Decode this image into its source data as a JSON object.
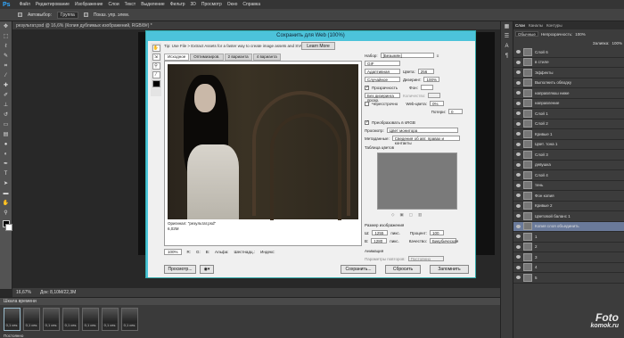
{
  "app": {
    "menu": [
      "Файл",
      "Редактирование",
      "Изображение",
      "Слои",
      "Текст",
      "Выделение",
      "Фильтр",
      "3D",
      "Просмотр",
      "Окно",
      "Справка"
    ],
    "options": {
      "autoselect": "Автовыбор:",
      "group": "Группа",
      "show_controls": "Показ. упр. элем."
    },
    "doc_tab": "результат.psd @ 16,6% (Копия дублимых изображений, RGB/8#) *",
    "status": {
      "zoom": "16,67%",
      "doc": "Док: 8,10M/22,3M"
    }
  },
  "timeline": {
    "title": "Шкала времени",
    "frames": [
      {
        "n": "1",
        "d": "0,1 сек."
      },
      {
        "n": "2",
        "d": "0,1 сек."
      },
      {
        "n": "3",
        "d": "0,1 сек."
      },
      {
        "n": "4",
        "d": "0,1 сек."
      },
      {
        "n": "5",
        "d": "0,1 сек."
      },
      {
        "n": "6",
        "d": "0,1 сек."
      },
      {
        "n": "7",
        "d": "0,1 сек."
      }
    ],
    "loop": "Постоянно"
  },
  "layers": {
    "tabs": [
      "Слои",
      "Каналы",
      "Контуры"
    ],
    "blend": "Обычные",
    "opacity_label": "Непрозрачность:",
    "opacity": "100%",
    "fill_label": "Заливка:",
    "fill": "100%",
    "items": [
      {
        "name": "Слой 6"
      },
      {
        "name": "в стиле"
      },
      {
        "name": "Эффекты"
      },
      {
        "name": "Выполнить обводку"
      },
      {
        "name": "направляюш ниже"
      },
      {
        "name": "направление"
      },
      {
        "name": "Слой 1"
      },
      {
        "name": "Слой 2"
      },
      {
        "name": "Кривые 1"
      },
      {
        "name": "Цвет. тона 1"
      },
      {
        "name": "Слой 3"
      },
      {
        "name": "девушка"
      },
      {
        "name": "Слой 4"
      },
      {
        "name": "тень"
      },
      {
        "name": "Фон копия"
      },
      {
        "name": "Кривые 2"
      },
      {
        "name": "Цветовой баланс 1"
      },
      {
        "name": "Копия слоя объединить"
      },
      {
        "name": "1"
      },
      {
        "name": "2"
      },
      {
        "name": "3"
      },
      {
        "name": "4"
      },
      {
        "name": "5"
      }
    ]
  },
  "dialog": {
    "title": "Сохранить для Web (100%)",
    "tip": "Tip: Use File > Extract Assets for a faster way to create image assets and SVG",
    "learn_more": "Learn More",
    "tabs": [
      "Исходное",
      "Оптимизиров.",
      "2 варианта",
      "4 варианта"
    ],
    "caption_line1": "Оригинал: \"результат.psd\"",
    "caption_line2": "6,02M",
    "zoom": "100%",
    "bottom": {
      "r": "R:",
      "g": "G:",
      "b": "B:",
      "alpha": "Альфа:",
      "hex": "Шестнадц.:",
      "index": "Индекс:"
    },
    "preview_btn": "Просмотр...",
    "save_btn": "Сохранить...",
    "reset_btn": "Сбросить",
    "remember_btn": "Запомнить",
    "settings": {
      "preset_label": "Набор:",
      "preset": "[Безымян]",
      "format": "GIF",
      "reduction": "Адаптивная",
      "dither_algo": "Случайное",
      "colors_label": "Цвета:",
      "colors": "256",
      "dither_label": "Дизеринг:",
      "dither": "100%",
      "transparency": "Прозрачность",
      "matte_label": "Фон:",
      "no_dither": "Без дизеринга прозр.",
      "amount_label": "Количество:",
      "interlaced": "Чересстрочно",
      "websnap_label": "Web-цвета:",
      "websnap": "0%",
      "lossy_label": "Потери:",
      "lossy": "0",
      "srgb": "Преобразовать в sRGB",
      "preview_label": "Просмотр:",
      "preview_val": "Цвет монитора",
      "meta_label": "Метаданные:",
      "meta_val": "Сведения об авт. правах и контакты",
      "color_table": "Таблица цветов",
      "image_size": "Размер изображения",
      "w_label": "Ш:",
      "w": "1255",
      "h_label": "В:",
      "h": "1280",
      "px": "пикс.",
      "percent_label": "Процент:",
      "percent": "100",
      "quality_label": "Качество:",
      "quality": "Бикубическая",
      "animation": "Анимация",
      "loop_label": "Параметры повторов:",
      "loop_val": "Постоянно"
    }
  },
  "watermark": {
    "line1": "Foto",
    "line2": "komok.ru"
  }
}
